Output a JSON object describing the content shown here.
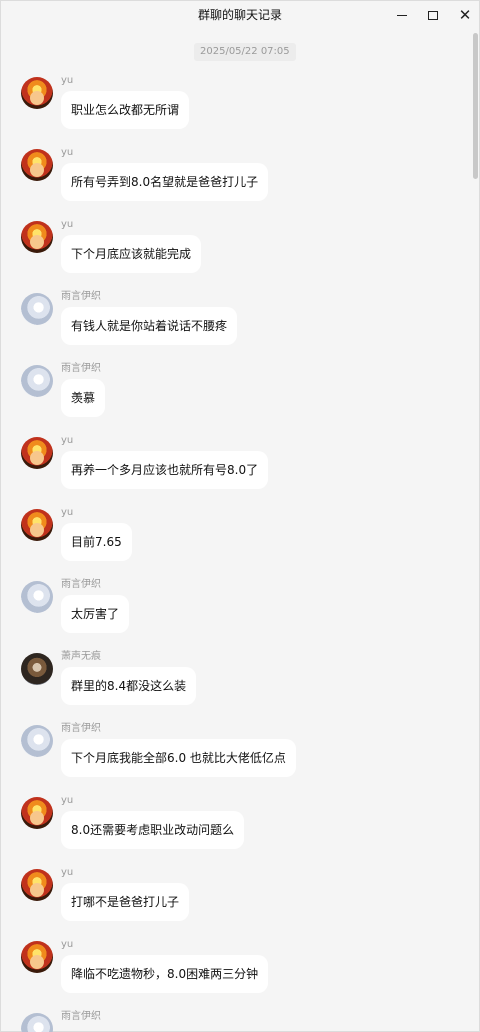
{
  "window": {
    "title": "群聊的聊天记录",
    "controls": {
      "minimize": "minimize-icon",
      "maximize": "maximize-icon",
      "close": "close-icon"
    }
  },
  "chat": {
    "date": "2025/05/22 07:05",
    "messages": [
      {
        "sender": "yu",
        "avatar": "yu",
        "text": "职业怎么改都无所谓"
      },
      {
        "sender": "yu",
        "avatar": "yu",
        "text": "所有号弄到8.0名望就是爸爸打儿子"
      },
      {
        "sender": "yu",
        "avatar": "yu",
        "text": "下个月底应该就能完成"
      },
      {
        "sender": "雨言伊织",
        "avatar": "yuyan",
        "text": "有钱人就是你站着说话不腰疼"
      },
      {
        "sender": "雨言伊织",
        "avatar": "yuyan",
        "text": "羡慕"
      },
      {
        "sender": "yu",
        "avatar": "yu",
        "text": "再养一个多月应该也就所有号8.0了"
      },
      {
        "sender": "yu",
        "avatar": "yu",
        "text": "目前7.65"
      },
      {
        "sender": "雨言伊织",
        "avatar": "yuyan",
        "text": "太厉害了"
      },
      {
        "sender": "萧声无痕",
        "avatar": "xiao",
        "text": "群里的8.4都没这么装"
      },
      {
        "sender": "雨言伊织",
        "avatar": "yuyan",
        "text": "下个月底我能全部6.0 也就比大佬低亿点"
      },
      {
        "sender": "yu",
        "avatar": "yu",
        "text": "8.0还需要考虑职业改动问题么"
      },
      {
        "sender": "yu",
        "avatar": "yu",
        "text": "打哪不是爸爸打儿子"
      },
      {
        "sender": "yu",
        "avatar": "yu",
        "text": "降临不吃遗物秒，8.0困难两三分钟"
      },
      {
        "sender": "雨言伊织",
        "avatar": "yuyan",
        "text": ""
      }
    ]
  }
}
